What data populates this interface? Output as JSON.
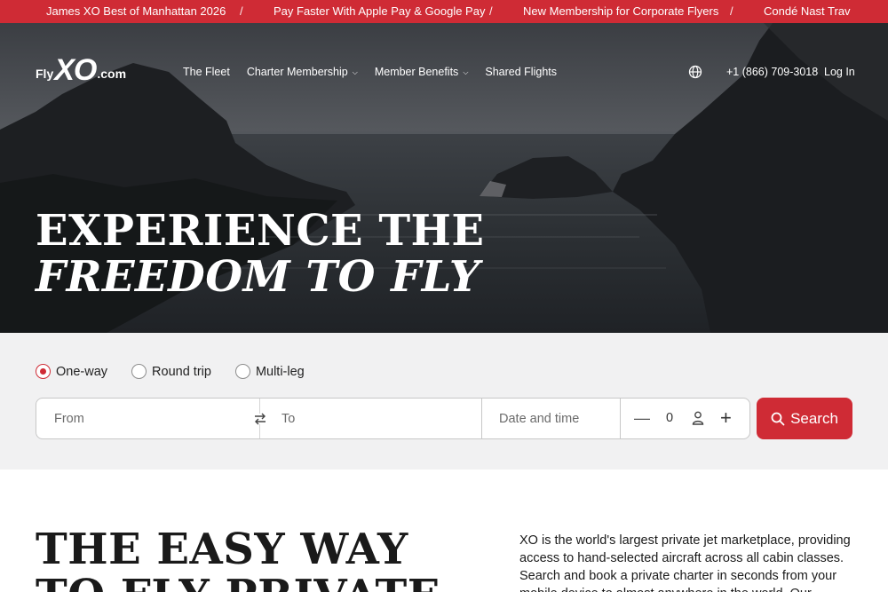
{
  "ticker": {
    "items": [
      "James XO Best of Manhattan 2026",
      "Pay Faster With Apple Pay & Google Pay",
      "New Membership for Corporate Flyers",
      "Condé Nast Trav"
    ],
    "separator": "/"
  },
  "brand": {
    "fly": "Fly",
    "xo": "XO",
    "com": ".com"
  },
  "nav": {
    "items": [
      {
        "label": "The Fleet",
        "dropdown": false
      },
      {
        "label": "Charter Membership",
        "dropdown": true
      },
      {
        "label": "Member Benefits",
        "dropdown": true
      },
      {
        "label": "Shared Flights",
        "dropdown": false
      }
    ],
    "phone": "+1 (866) 709-3018",
    "login": "Log In"
  },
  "hero": {
    "line1": "EXPERIENCE THE",
    "line2": "FREEDOM TO FLY"
  },
  "search": {
    "trip_types": [
      {
        "label": "One-way",
        "selected": true
      },
      {
        "label": "Round trip",
        "selected": false
      },
      {
        "label": "Multi-leg",
        "selected": false
      }
    ],
    "from_placeholder": "From",
    "to_placeholder": "To",
    "date_placeholder": "Date and time",
    "passengers": "0",
    "button_label": "Search"
  },
  "intro": {
    "heading_line1": "THE EASY WAY",
    "heading_line2": "TO FLY PRIVATE",
    "paragraph": "XO is the world's largest private jet marketplace, providing access to hand-selected aircraft across all cabin classes. Search and book a private charter in seconds from your mobile device to almost anywhere in the world. Our aviation"
  },
  "colors": {
    "accent": "#cf2b35",
    "panel": "#f1f1f2"
  }
}
